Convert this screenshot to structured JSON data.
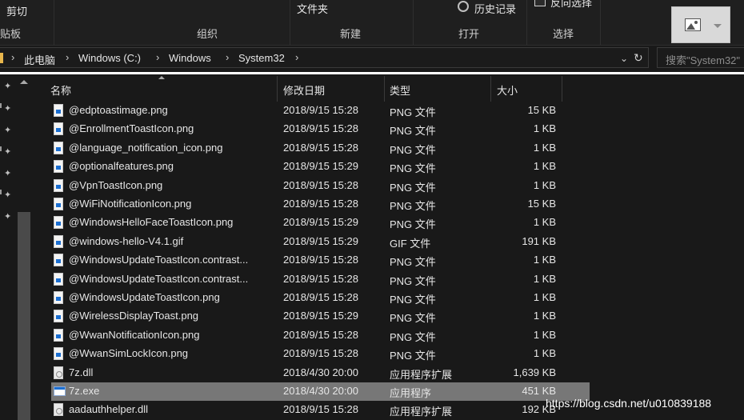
{
  "ribbon": {
    "cut_label": "剪切",
    "folder_label": "文件夹",
    "history_label": "历史记录",
    "reverse_select_label": "反向选择",
    "group_clipboard": "贴板",
    "group_organize": "组织",
    "group_new": "新建",
    "group_open": "打开",
    "group_select": "选择"
  },
  "address": {
    "crumbs": [
      "此电脑",
      "Windows (C:)",
      "Windows",
      "System32"
    ],
    "search_placeholder": "搜索\"System32\""
  },
  "columns": {
    "name": "名称",
    "date": "修改日期",
    "type": "类型",
    "size": "大小"
  },
  "files": [
    {
      "name": "@edptoastimage.png",
      "date": "2018/9/15 15:28",
      "type": "PNG 文件",
      "size": "15 KB",
      "icon": "png-file-icon"
    },
    {
      "name": "@EnrollmentToastIcon.png",
      "date": "2018/9/15 15:28",
      "type": "PNG 文件",
      "size": "1 KB",
      "icon": "png-file-icon"
    },
    {
      "name": "@language_notification_icon.png",
      "date": "2018/9/15 15:28",
      "type": "PNG 文件",
      "size": "1 KB",
      "icon": "png-file-icon"
    },
    {
      "name": "@optionalfeatures.png",
      "date": "2018/9/15 15:29",
      "type": "PNG 文件",
      "size": "1 KB",
      "icon": "png-file-icon"
    },
    {
      "name": "@VpnToastIcon.png",
      "date": "2018/9/15 15:28",
      "type": "PNG 文件",
      "size": "1 KB",
      "icon": "png-file-icon"
    },
    {
      "name": "@WiFiNotificationIcon.png",
      "date": "2018/9/15 15:28",
      "type": "PNG 文件",
      "size": "15 KB",
      "icon": "png-file-icon"
    },
    {
      "name": "@WindowsHelloFaceToastIcon.png",
      "date": "2018/9/15 15:29",
      "type": "PNG 文件",
      "size": "1 KB",
      "icon": "png-file-icon"
    },
    {
      "name": "@windows-hello-V4.1.gif",
      "date": "2018/9/15 15:29",
      "type": "GIF 文件",
      "size": "191 KB",
      "icon": "gif-file-icon"
    },
    {
      "name": "@WindowsUpdateToastIcon.contrast...",
      "date": "2018/9/15 15:28",
      "type": "PNG 文件",
      "size": "1 KB",
      "icon": "png-file-icon"
    },
    {
      "name": "@WindowsUpdateToastIcon.contrast...",
      "date": "2018/9/15 15:28",
      "type": "PNG 文件",
      "size": "1 KB",
      "icon": "png-file-icon"
    },
    {
      "name": "@WindowsUpdateToastIcon.png",
      "date": "2018/9/15 15:28",
      "type": "PNG 文件",
      "size": "1 KB",
      "icon": "png-file-icon"
    },
    {
      "name": "@WirelessDisplayToast.png",
      "date": "2018/9/15 15:29",
      "type": "PNG 文件",
      "size": "1 KB",
      "icon": "png-file-icon"
    },
    {
      "name": "@WwanNotificationIcon.png",
      "date": "2018/9/15 15:28",
      "type": "PNG 文件",
      "size": "1 KB",
      "icon": "png-file-icon"
    },
    {
      "name": "@WwanSimLockIcon.png",
      "date": "2018/9/15 15:28",
      "type": "PNG 文件",
      "size": "1 KB",
      "icon": "png-file-icon"
    },
    {
      "name": "7z.dll",
      "date": "2018/4/30 20:00",
      "type": "应用程序扩展",
      "size": "1,639 KB",
      "icon": "dll-file-icon"
    },
    {
      "name": "7z.exe",
      "date": "2018/4/30 20:00",
      "type": "应用程序",
      "size": "451 KB",
      "icon": "exe-file-icon",
      "selected": true
    },
    {
      "name": "aadauthhelper.dll",
      "date": "2018/9/15 15:28",
      "type": "应用程序扩展",
      "size": "192 KB",
      "icon": "dll-file-icon"
    }
  ],
  "watermark": "https://blog.csdn.net/u010839188"
}
